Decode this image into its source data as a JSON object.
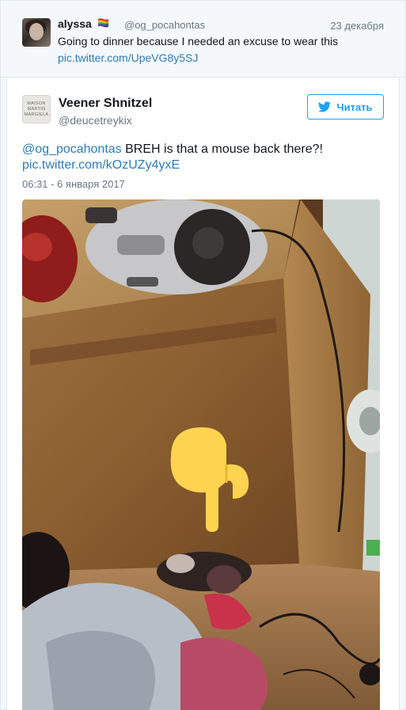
{
  "quoted_tweet": {
    "name": "alyssa",
    "emojis": "🏳️‍🌈",
    "handle": "@og_pocahontas",
    "date": "23 декабря",
    "text": "Going to dinner because I needed an excuse to wear this",
    "link": "pic.twitter.com/UpeVG8y5SJ"
  },
  "tweet": {
    "avatar_text": [
      "MAISON",
      "MARTIN",
      "MARGIELA"
    ],
    "name": "Veener Shnitzel",
    "handle": "@deucetreykix",
    "follow_label": "Читать",
    "mention": "@og_pocahontas",
    "text": " BREH is that a mouse back there?!",
    "link": "pic.twitter.com/kOzUZy4yxE",
    "timestamp": "06:31 - 6 января 2017"
  },
  "colors": {
    "accent": "#1da1f2",
    "link": "#2b7bb9",
    "secondary_text": "#657786",
    "background": "#f5f8fa"
  },
  "icons": {
    "follow_icon": "twitter-bird-icon",
    "photo_overlay": "pointing-down-emoji"
  }
}
